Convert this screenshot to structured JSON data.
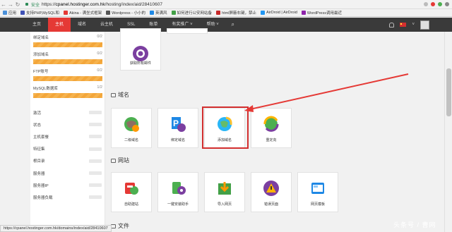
{
  "browser": {
    "secure_label": "安全",
    "url_prefix": "https://",
    "url_host": "cpanel.hostinger.com.hk",
    "url_path": "/hosting/index/aid/28410607",
    "bookmarks": [
      {
        "label": "应用",
        "color": "#4a90d9"
      },
      {
        "label": "支持PHP,MySQL和",
        "color": "#3f51b5"
      },
      {
        "label": "Akina - 满坐式框架",
        "color": "#e53935"
      },
      {
        "label": "Wordpress - 小小的",
        "color": "#555555"
      },
      {
        "label": "英满风",
        "color": "#1e88e5"
      },
      {
        "label": "如何进行公安网站备",
        "color": "#43a047"
      },
      {
        "label": "html屏蔽右键，禁止",
        "color": "#c62828"
      },
      {
        "label": "AirDroid | AirDroid",
        "color": "#2196f3"
      },
      {
        "label": "WordPress调用最近",
        "color": "#8e24aa"
      }
    ]
  },
  "topnav": {
    "items": [
      "主页",
      "主机",
      "域名",
      "云主机",
      "SSL",
      "账单",
      "有奖推广 ˅",
      "帮助 ˅"
    ],
    "active_index": 1,
    "flag_caret": "˅"
  },
  "sidebar": {
    "stats": [
      {
        "label": "绑定域名",
        "count": "0/2"
      },
      {
        "label": "添加域名",
        "count": "0/2"
      },
      {
        "label": "FTP账号",
        "count": "0/2"
      },
      {
        "label": "MySQL数据库",
        "count": "1/2"
      }
    ],
    "info": [
      "激活",
      "状态",
      "主机套餐",
      "特征集",
      "根目录",
      "服务器",
      "服务器IP",
      "服务器负载"
    ]
  },
  "main": {
    "email_card": {
      "label": "获取所有邮件",
      "icon": "email-icon"
    },
    "sections": [
      {
        "title": "域名",
        "icon": "globe-icon"
      },
      {
        "title": "网站",
        "icon": "monitor-icon"
      },
      {
        "title": "文件",
        "icon": "file-icon"
      }
    ],
    "domain_cards": [
      {
        "label": "二级域名",
        "icon": "subdomain-icon"
      },
      {
        "label": "绑定域名",
        "icon": "parked-domain-icon"
      },
      {
        "label": "添加域名",
        "icon": "addon-domain-icon"
      },
      {
        "label": "重定向",
        "icon": "redirect-icon"
      }
    ],
    "website_cards": [
      {
        "label": "自助建站",
        "icon": "website-builder-icon"
      },
      {
        "label": "一键安装助手",
        "icon": "auto-installer-icon"
      },
      {
        "label": "导入网页",
        "icon": "import-icon"
      },
      {
        "label": "错误页面",
        "icon": "error-page-icon"
      },
      {
        "label": "网页模板",
        "icon": "template-icon"
      }
    ]
  },
  "status_bar": {
    "text": "https://cpanel.hostinger.com.hk/domains/index/aid/28410607"
  },
  "watermark": {
    "text": "头条号 / 曹网"
  },
  "colors": {
    "accent": "#e53935",
    "progress": "#f6b34e",
    "nav_bg": "#3a3a3a"
  }
}
